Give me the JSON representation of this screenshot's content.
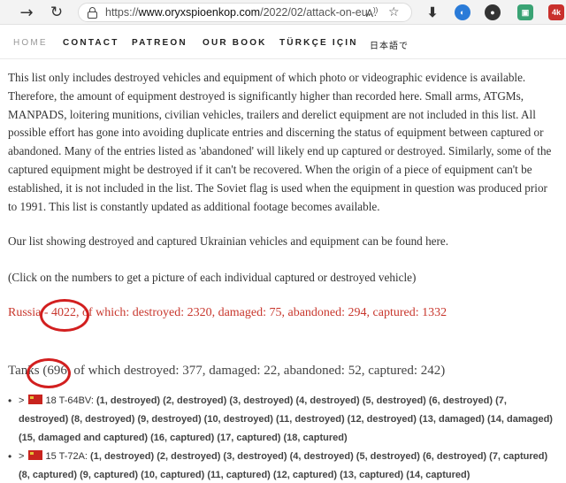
{
  "browser": {
    "url_scheme": "https://",
    "url_host": "www.oryxspioenkop.com",
    "url_path": "/2022/02/attack-on-eu...",
    "read_aloud_label": "A",
    "extensions": [
      "download-icon",
      "ext-blue",
      "ext-dark",
      "ext-green",
      "ext-4k"
    ],
    "ext_4k_label": "4k"
  },
  "nav": {
    "items": [
      "HOME",
      "CONTACT",
      "PATREON",
      "OUR BOOK",
      "TÜRKÇE IÇIN",
      "日本語で"
    ]
  },
  "intro": {
    "paragraph": "This list only includes destroyed vehicles and equipment of which photo or videographic evidence is available. Therefore, the amount of equipment destroyed is significantly higher than recorded here. Small arms, ATGMs, MANPADS, loitering munitions, civilian vehicles, trailers and derelict equipment are not included in this list. All possible effort has gone into avoiding duplicate entries and discerning the status of equipment between captured or abandoned. Many of the entries listed as 'abandoned' will likely end up captured or destroyed. Similarly, some of the captured equipment might be destroyed if it can't be recovered. When the origin of a piece of equipment can't be established, it is not included in the list. The Soviet flag is used when the equipment in question was produced prior to 1991. This list is constantly updated as additional footage becomes available.",
    "ukraine_text": "Our list showing destroyed and captured Ukrainian vehicles and equipment can be found ",
    "ukraine_link": "here",
    "ukraine_end": ".",
    "click_note": "(Click on the numbers to get a picture of each individual captured or destroyed vehicle)"
  },
  "russia_total": "Russia - 4022, of which: destroyed: 2320, damaged: 75, abandoned: 294, captured: 1332",
  "tanks_total": "Tanks (696, of which destroyed: 377, damaged: 22, abandoned: 52, captured: 242)",
  "entries": [
    {
      "prefix": "> ",
      "count_name": "18 T-64BV: ",
      "items": "(1, destroyed) (2, destroyed) (3, destroyed) (4, destroyed) (5, destroyed) (6, destroyed) (7, destroyed) (8, destroyed) (9, destroyed) (10, destroyed) (11, destroyed) (12, destroyed) (13, damaged) (14, damaged) (15, damaged and captured) (16, captured) (17, captured) (18, captured)"
    },
    {
      "prefix": "> ",
      "count_name": "15 T-72A: ",
      "items": "(1, destroyed) (2, destroyed) (3, destroyed) (4, destroyed) (5, destroyed) (6, destroyed) (7, captured) (8, captured) (9, captured) (10, captured) (11, captured) (12, captured) (13, captured) (14, captured)"
    }
  ],
  "colors": {
    "russia_red": "#c8372d",
    "annotation_ring": "#d21f1f",
    "flag_red": "#c8241e"
  }
}
